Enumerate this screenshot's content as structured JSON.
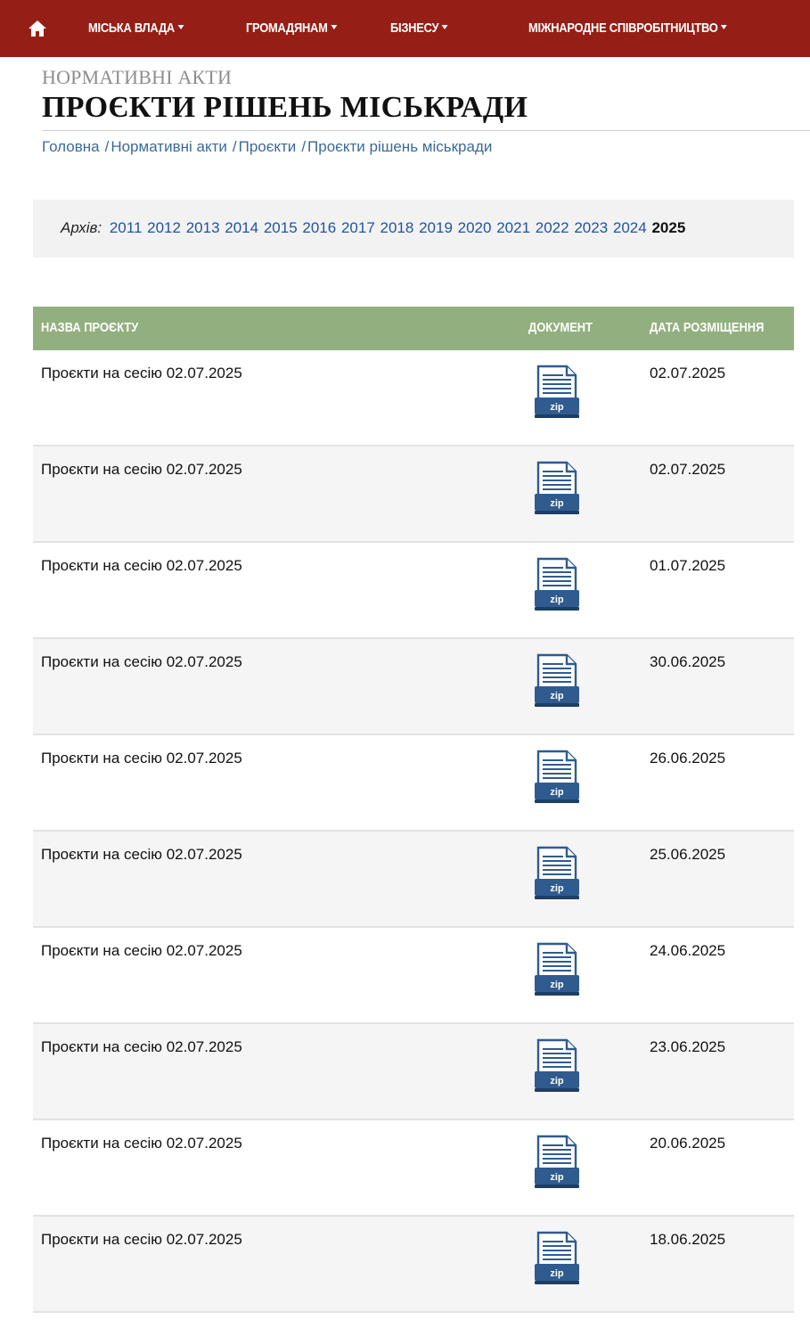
{
  "nav": {
    "home_icon": "home-icon",
    "items": [
      {
        "label": "МІСЬКА ВЛАДА"
      },
      {
        "label": "ГРОМАДЯНАМ"
      },
      {
        "label": "БІЗНЕСУ"
      },
      {
        "label": "МІЖНАРОДНЕ СПІВРОБІТНИЦТВО"
      }
    ]
  },
  "header": {
    "section": "НОРМАТИВНІ АКТИ",
    "title": "ПРОЄКТИ РІШЕНЬ МІСЬКРАДИ"
  },
  "breadcrumb": [
    {
      "label": "Головна"
    },
    {
      "label": "Нормативні акти"
    },
    {
      "label": "Проєкти"
    },
    {
      "label": "Проєкти рішень міськради"
    }
  ],
  "archive": {
    "label": "Архів:",
    "years": [
      "2011",
      "2012",
      "2013",
      "2014",
      "2015",
      "2016",
      "2017",
      "2018",
      "2019",
      "2020",
      "2021",
      "2022",
      "2023",
      "2024"
    ],
    "current_year": "2025"
  },
  "table": {
    "headers": {
      "name": "НАЗВА ПРОЄКТУ",
      "document": "ДОКУМЕНТ",
      "date": "ДАТА РОЗМІЩЕННЯ"
    },
    "rows": [
      {
        "name": "Проєкти на сесію 02.07.2025",
        "doc_label": "zip",
        "date": "02.07.2025"
      },
      {
        "name": "Проєкти на сесію 02.07.2025",
        "doc_label": "zip",
        "date": "02.07.2025"
      },
      {
        "name": "Проєкти на сесію 02.07.2025",
        "doc_label": "zip",
        "date": "01.07.2025"
      },
      {
        "name": "Проєкти на сесію 02.07.2025",
        "doc_label": "zip",
        "date": "30.06.2025"
      },
      {
        "name": "Проєкти на сесію 02.07.2025",
        "doc_label": "zip",
        "date": "26.06.2025"
      },
      {
        "name": "Проєкти на сесію 02.07.2025",
        "doc_label": "zip",
        "date": "25.06.2025"
      },
      {
        "name": "Проєкти на сесію 02.07.2025",
        "doc_label": "zip",
        "date": "24.06.2025"
      },
      {
        "name": "Проєкти на сесію 02.07.2025",
        "doc_label": "zip",
        "date": "23.06.2025"
      },
      {
        "name": "Проєкти на сесію 02.07.2025",
        "doc_label": "zip",
        "date": "20.06.2025"
      },
      {
        "name": "Проєкти на сесію 02.07.2025",
        "doc_label": "zip",
        "date": "18.06.2025"
      }
    ]
  },
  "colors": {
    "nav_bg": "#951f16",
    "table_header_bg": "#92b07f",
    "link": "#1f55a0",
    "zip_icon": "#2f5b8f"
  }
}
